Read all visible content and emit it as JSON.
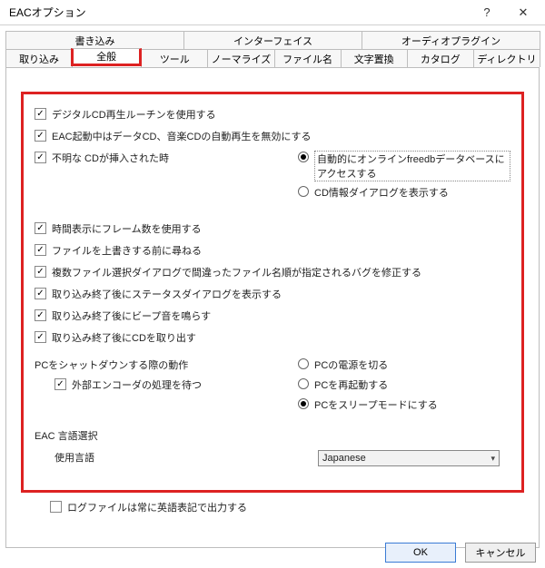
{
  "window": {
    "title": "EACオプション"
  },
  "tabsTop": [
    "書き込み",
    "インターフェイス",
    "オーディオプラグイン"
  ],
  "tabsBottom": [
    "取り込み",
    "全般",
    "ツール",
    "ノーマライズ",
    "ファイル名",
    "文字置換",
    "カタログ",
    "ディレクトリ"
  ],
  "checks": {
    "c1": "デジタルCD再生ルーチンを使用する",
    "c2": "EAC起動中はデータCD、音楽CDの自動再生を無効にする",
    "c3": "不明な CDが挿入された時",
    "c4": "時間表示にフレーム数を使用する",
    "c5": "ファイルを上書きする前に尋ねる",
    "c6": "複数ファイル選択ダイアログで間違ったファイル名順が指定されるバグを修正する",
    "c7": "取り込み終了後にステータスダイアログを表示する",
    "c8": "取り込み終了後にビープ音を鳴らす",
    "c9": "取り込み終了後にCDを取り出す",
    "shutdown": "PCをシャットダウンする際の動作",
    "c10": "外部エンコーダの処理を待つ",
    "langSection": "EAC 言語選択",
    "langLabel": "使用言語",
    "c11": "ログファイルは常に英語表記で出力する"
  },
  "radios": {
    "r1": "自動的にオンラインfreedbデータベースにアクセスする",
    "r2": "CD情報ダイアログを表示する",
    "r3": "PCの電源を切る",
    "r4": "PCを再起動する",
    "r5": "PCをスリープモードにする"
  },
  "lang": {
    "value": "Japanese"
  },
  "buttons": {
    "ok": "OK",
    "cancel": "キャンセル"
  }
}
